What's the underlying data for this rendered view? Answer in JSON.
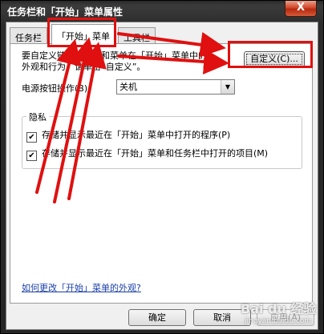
{
  "window": {
    "title": "任务栏和「开始」菜单属性",
    "close_label": "X"
  },
  "tabs": [
    {
      "label": "任务栏",
      "active": false
    },
    {
      "label": "「开始」菜单",
      "active": true
    },
    {
      "label": "工具栏",
      "active": false
    }
  ],
  "panel": {
    "description_line1": "要自定义链接、图标和菜单在「开始」菜单中的",
    "description_line2": "外观和行为，请单击“自定义”。",
    "customize_button": "自定义(C)...",
    "power_label": "电源按钮操作(B):",
    "power_value": "关机",
    "privacy_legend": "隐私",
    "checkboxes": [
      {
        "label": "存储并显示最近在「开始」菜单中打开的程序(P)",
        "checked": true
      },
      {
        "label": "存储并显示最近在「开始」菜单和任务栏中打开的项目(M)",
        "checked": true
      }
    ],
    "help_link": "如何更改「开始」菜单的外观?"
  },
  "buttons": {
    "ok": "确定",
    "cancel": "取消",
    "apply": "应用(A)"
  },
  "annotations": {
    "accent_color": "#e01010"
  },
  "watermark": {
    "brand": "Bai du 经验",
    "url": "jingyan.baidu.com"
  }
}
